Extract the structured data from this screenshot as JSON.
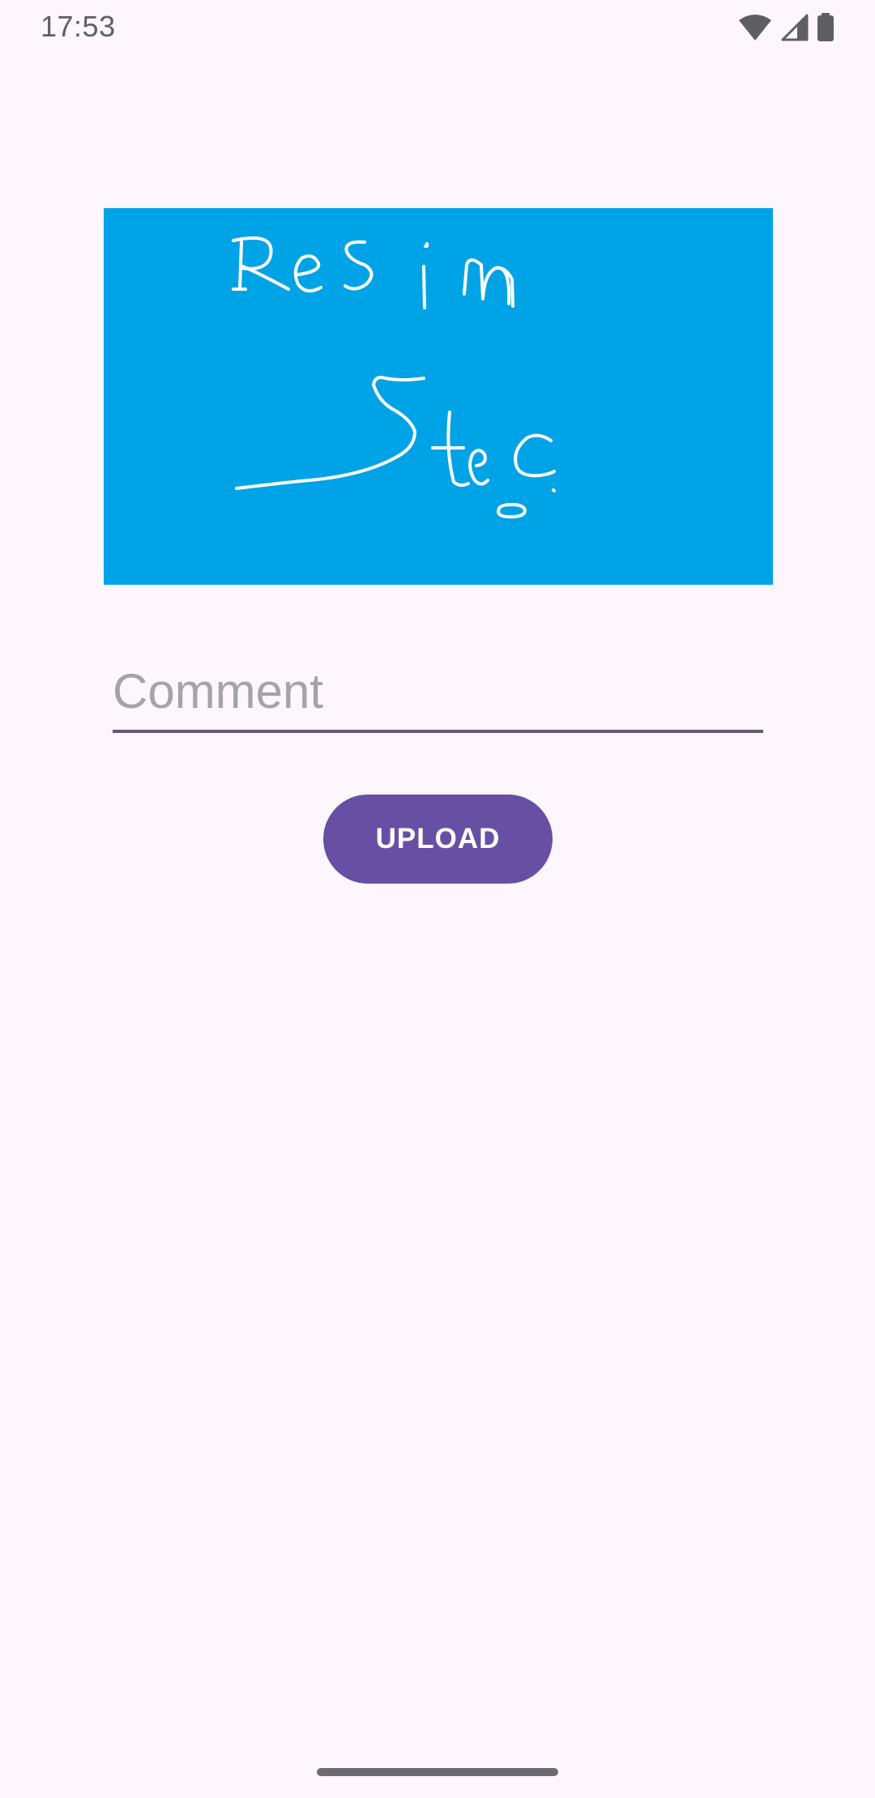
{
  "status_bar": {
    "time": "17:53",
    "icons": [
      "wifi-icon",
      "cell-signal-icon",
      "battery-icon"
    ]
  },
  "image_picker": {
    "handwritten_text": "Resim Seç",
    "background_color": "#00a3e6"
  },
  "comment": {
    "placeholder": "Comment",
    "value": ""
  },
  "upload": {
    "label": "UPLOAD",
    "color": "#6750a4"
  },
  "colors": {
    "background": "#fdf7fd",
    "accent": "#6750a4"
  }
}
